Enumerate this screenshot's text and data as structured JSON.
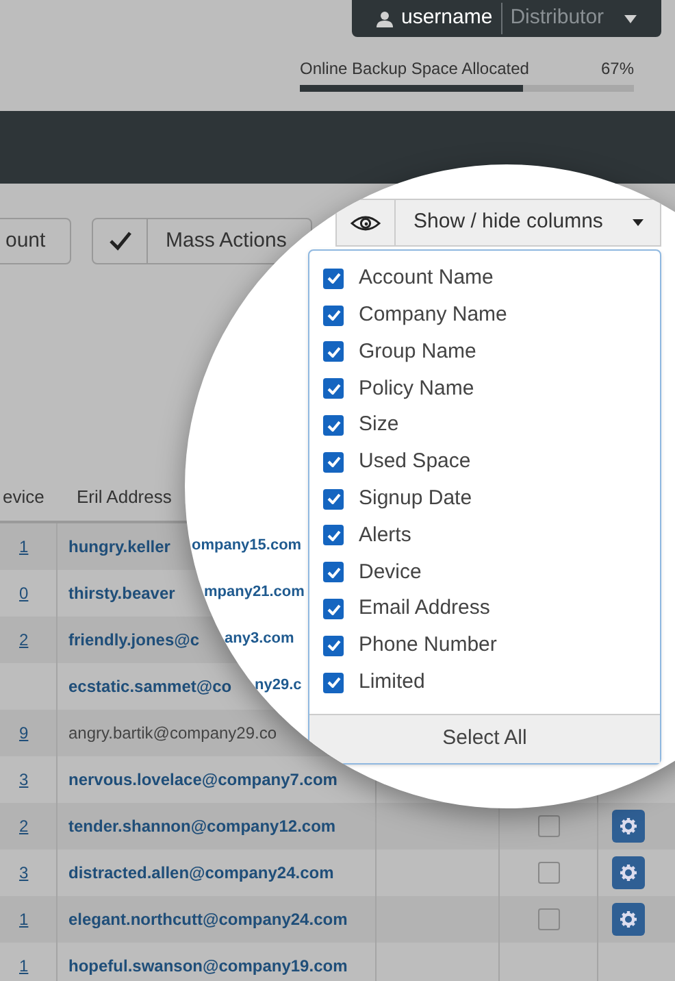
{
  "user_menu": {
    "username": "username",
    "role": "Distributor"
  },
  "backup": {
    "label": "Online Backup Space Allocated",
    "reading": "67%",
    "level": 0.67
  },
  "toolbar": {
    "partial_button": "ount",
    "mass_actions": "Mass Actions"
  },
  "table": {
    "columns": [
      "evice",
      "Eril Address"
    ],
    "rows": [
      {
        "device": "1",
        "email": "hungry.keller",
        "bold": true
      },
      {
        "device": "0",
        "email": "thirsty.beaver",
        "bold": true
      },
      {
        "device": "2",
        "email": "friendly.jones@c",
        "bold": true
      },
      {
        "device": "",
        "email": "ecstatic.sammet@co",
        "bold": true
      },
      {
        "device": "9",
        "email": "angry.bartik@company29.co",
        "bold": false
      },
      {
        "device": "3",
        "email": "nervous.lovelace@company7.com",
        "bold": true
      },
      {
        "device": "2",
        "email": "tender.shannon@company12.com",
        "bold": true,
        "checked": false
      },
      {
        "device": "3",
        "email": "distracted.allen@company24.com",
        "bold": true,
        "checked": false
      },
      {
        "device": "1",
        "email": "elegant.northcutt@company24.com",
        "bold": true,
        "checked": false
      },
      {
        "device": "1",
        "email": "hopeful.swanson@company19.com",
        "bold": true
      }
    ]
  },
  "lens": {
    "email_fragments": [
      "ompany15.com",
      "mpany21.com",
      "any3.com",
      "ny29.c"
    ],
    "columns_button": "Show / hide columns",
    "columns": [
      {
        "label": "Account Name",
        "checked": true
      },
      {
        "label": "Company Name",
        "checked": true
      },
      {
        "label": "Group Name",
        "checked": true
      },
      {
        "label": "Policy Name",
        "checked": true
      },
      {
        "label": "Size",
        "checked": true
      },
      {
        "label": "Used Space",
        "checked": true
      },
      {
        "label": "Signup Date",
        "checked": true
      },
      {
        "label": "Alerts",
        "checked": true
      },
      {
        "label": "Device",
        "checked": true
      },
      {
        "label": "Email Address",
        "checked": true
      },
      {
        "label": "Phone Number",
        "checked": true
      },
      {
        "label": "Limited",
        "checked": true
      }
    ],
    "select_all": "Select All"
  }
}
